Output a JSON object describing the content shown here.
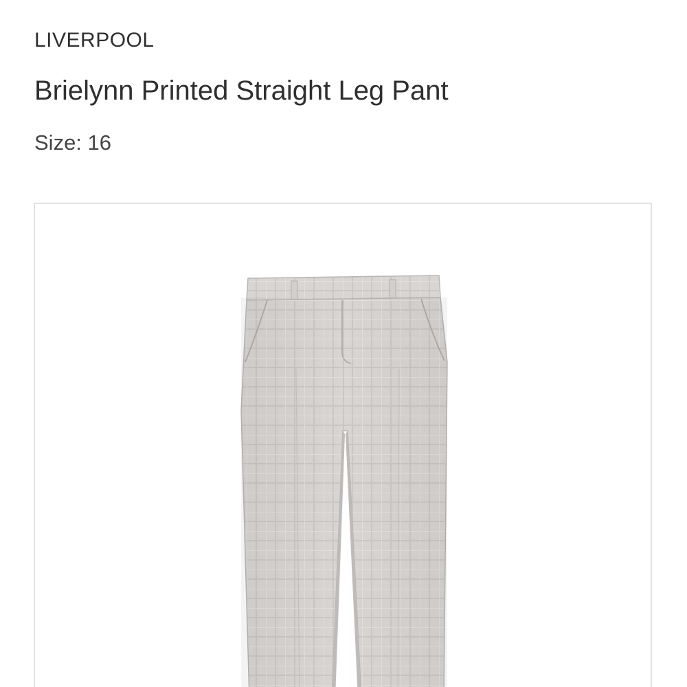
{
  "product": {
    "brand": "LIVERPOOL",
    "name": "Brielynn Printed Straight Leg Pant",
    "size_label": "Size:",
    "size_value": "16",
    "image_icon": "pants-photo"
  }
}
